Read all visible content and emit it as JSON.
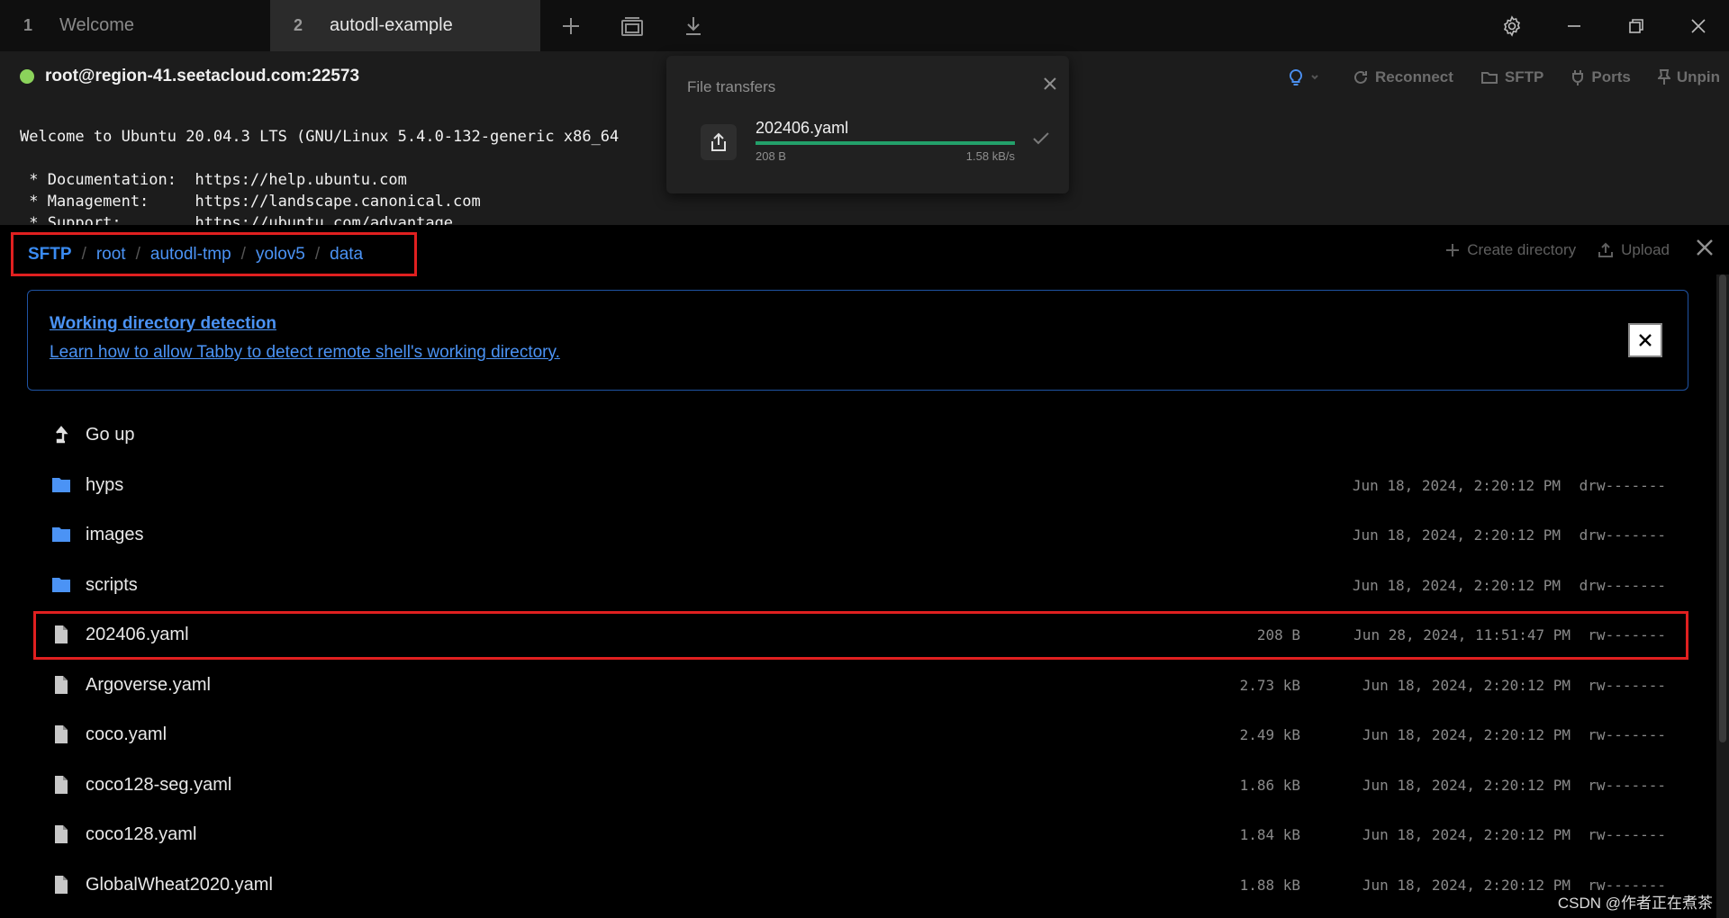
{
  "tabs": [
    {
      "num": "1",
      "label": "Welcome"
    },
    {
      "num": "2",
      "label": "autodl-example"
    }
  ],
  "terminal": {
    "host": "root@region-41.seetacloud.com:22573",
    "actions": {
      "reconnect": "Reconnect",
      "sftp": "SFTP",
      "ports": "Ports",
      "unpin": "Unpin"
    },
    "lines": [
      "Welcome to Ubuntu 20.04.3 LTS (GNU/Linux 5.4.0-132-generic x86_64",
      " * Documentation:  https://help.ubuntu.com",
      " * Management:     https://landscape.canonical.com",
      " * Support:        https://ubuntu.com/advantage"
    ]
  },
  "file_transfers": {
    "title": "File transfers",
    "item": {
      "name": "202406.yaml",
      "size": "208 B",
      "speed": "1.58 kB/s",
      "progress": 1.0
    }
  },
  "sftp": {
    "breadcrumb": [
      "SFTP",
      "root",
      "autodl-tmp",
      "yolov5",
      "data"
    ],
    "actions": {
      "create_directory": "Create directory",
      "upload": "Upload"
    },
    "alert": {
      "title": "Working directory detection",
      "link": "Learn how to allow Tabby to detect remote shell's working directory."
    },
    "go_up": "Go up",
    "items": [
      {
        "type": "dir",
        "name": "hyps",
        "size": "",
        "date": "Jun 18, 2024, 2:20:12 PM",
        "perm": "drw-------"
      },
      {
        "type": "dir",
        "name": "images",
        "size": "",
        "date": "Jun 18, 2024, 2:20:12 PM",
        "perm": "drw-------"
      },
      {
        "type": "dir",
        "name": "scripts",
        "size": "",
        "date": "Jun 18, 2024, 2:20:12 PM",
        "perm": "drw-------"
      },
      {
        "type": "file",
        "name": "202406.yaml",
        "size": "208 B",
        "date": "Jun 28, 2024, 11:51:47 PM",
        "perm": "rw-------"
      },
      {
        "type": "file",
        "name": "Argoverse.yaml",
        "size": "2.73 kB",
        "date": "Jun 18, 2024, 2:20:12 PM",
        "perm": "rw-------"
      },
      {
        "type": "file",
        "name": "coco.yaml",
        "size": "2.49 kB",
        "date": "Jun 18, 2024, 2:20:12 PM",
        "perm": "rw-------"
      },
      {
        "type": "file",
        "name": "coco128-seg.yaml",
        "size": "1.86 kB",
        "date": "Jun 18, 2024, 2:20:12 PM",
        "perm": "rw-------"
      },
      {
        "type": "file",
        "name": "coco128.yaml",
        "size": "1.84 kB",
        "date": "Jun 18, 2024, 2:20:12 PM",
        "perm": "rw-------"
      },
      {
        "type": "file",
        "name": "GlobalWheat2020.yaml",
        "size": "1.88 kB",
        "date": "Jun 18, 2024, 2:20:12 PM",
        "perm": "rw-------"
      }
    ]
  },
  "watermark": "CSDN @作者正在煮茶",
  "colors": {
    "accent": "#4b93f5",
    "status_online": "#8bd35b",
    "progress": "#23a06a",
    "highlight": "#e02020"
  }
}
